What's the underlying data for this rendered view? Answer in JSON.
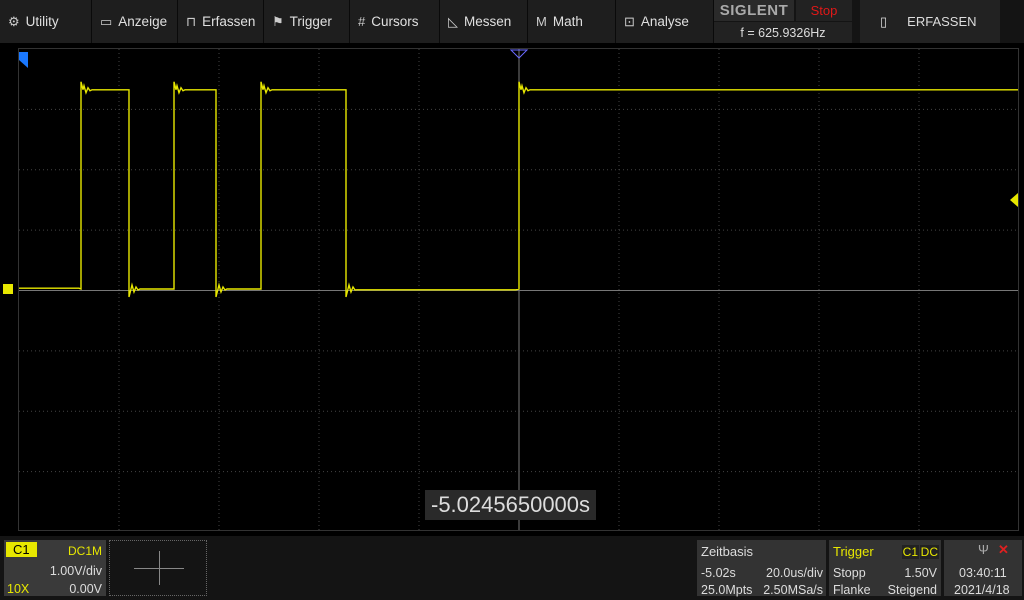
{
  "menu": [
    {
      "icon": "gear-icon",
      "glyph": "⚙",
      "label": "Utility"
    },
    {
      "icon": "monitor-icon",
      "glyph": "▭",
      "label": "Anzeige"
    },
    {
      "icon": "acquire-icon",
      "glyph": "⊓",
      "label": "Erfassen"
    },
    {
      "icon": "flag-icon",
      "glyph": "⚑",
      "label": "Trigger"
    },
    {
      "icon": "cursors-icon",
      "glyph": "#",
      "label": "Cursors"
    },
    {
      "icon": "measure-icon",
      "glyph": "◺",
      "label": "Messen"
    },
    {
      "icon": "math-icon",
      "glyph": "M",
      "label": "Math"
    },
    {
      "icon": "analyse-icon",
      "glyph": "⊡",
      "label": "Analyse"
    }
  ],
  "brand": {
    "logo": "SIGLENT",
    "status": "Stop",
    "frequency": "f = 625.9326Hz"
  },
  "acquire_button": "ERFASSEN",
  "time_readout": "-5.0245650000s",
  "channel": {
    "name": "C1",
    "coupling": "DC1M",
    "scale": "1.00V/div",
    "probe": "10X",
    "offset": "0.00V",
    "color": "#e8e800"
  },
  "timebase": {
    "title": "Zeitbasis",
    "delay": "-5.02s",
    "scale": "20.0us/div",
    "memory": "25.0Mpts",
    "sample_rate": "2.50MSa/s"
  },
  "trigger": {
    "title": "Trigger",
    "source": "C1",
    "coupling": "DC",
    "mode": "Stopp",
    "level": "1.50V",
    "type": "Flanke",
    "slope": "Steigend"
  },
  "clock": {
    "time": "03:40:11",
    "date": "2021/4/18"
  },
  "waveform": {
    "time_per_div_us": 20,
    "volts_per_div": 1,
    "high_v": 3.3,
    "low_v": 0,
    "edges_us": [
      -87.6,
      -78,
      -69,
      -60.6,
      -51.6,
      -34.6,
      0
    ]
  }
}
